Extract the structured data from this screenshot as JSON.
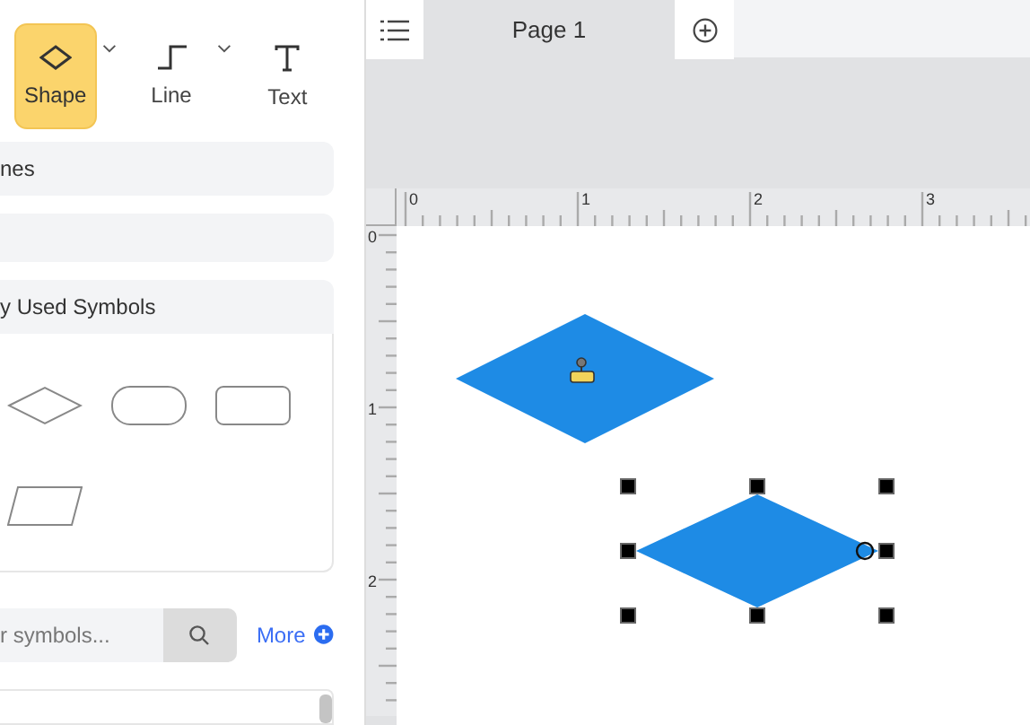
{
  "toolbar": {
    "tools": [
      {
        "kind": "shape",
        "label": "Shape",
        "selected": true,
        "dropdown": true
      },
      {
        "kind": "line",
        "label": "Line",
        "selected": false,
        "dropdown": true
      },
      {
        "kind": "text",
        "label": "Text",
        "selected": false,
        "dropdown": false
      }
    ]
  },
  "sidebar": {
    "sections": [
      {
        "label": "nes"
      }
    ],
    "library": {
      "title": "y Used Symbols",
      "symbols": [
        {
          "kind": "diamond"
        },
        {
          "kind": "terminator"
        },
        {
          "kind": "rectangle"
        },
        {
          "kind": "parallelogram"
        }
      ]
    },
    "search": {
      "placeholder": "r symbols..."
    },
    "more_link": "More"
  },
  "tabs": [
    {
      "label": "Page 1",
      "selected": true
    }
  ],
  "ruler": {
    "horizontal": [
      "0",
      "1",
      "2",
      "3"
    ],
    "vertical": [
      "0",
      "1",
      "2"
    ]
  },
  "canvas": {
    "shapes": [
      {
        "kind": "diamond",
        "selected": false
      },
      {
        "kind": "diamond",
        "selected": true
      }
    ]
  }
}
